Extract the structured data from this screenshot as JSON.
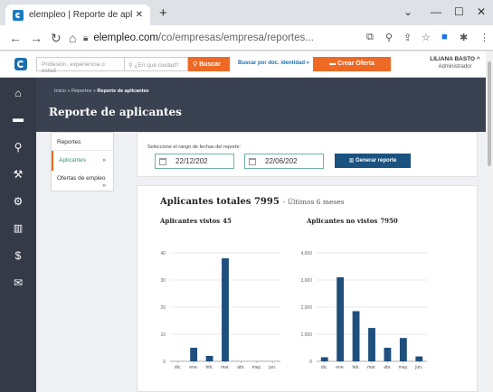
{
  "browser": {
    "tab_title": "elempleo | Reporte de aplicantes",
    "tab_close": "✕",
    "new_tab": "+",
    "url_host": "elempleo.com",
    "url_path": "/co/empresas/empresa/reportes...",
    "window_controls": {
      "chevron": "⌄",
      "minimize": "—",
      "maximize": "☐",
      "close": "✕"
    }
  },
  "site": {
    "search_placeholder": "Profesión, experiencia o estud",
    "city_placeholder": "¿En qué ciudad?",
    "search_button": "Buscar",
    "doc_search_link": "Buscar por doc. identidad »",
    "create_offer_button": "Crear Oferta",
    "user_name": "LILIANA BASTO",
    "user_role": "Administrador"
  },
  "page": {
    "breadcrumb": {
      "home": "Inicio",
      "sep": "»",
      "reports": "Reportes",
      "current": "Reporte de aplicantes"
    },
    "title": "Reporte de aplicantes"
  },
  "report_menu": {
    "header": "Reportes",
    "items": [
      {
        "label": "Aplicantes",
        "chevron": "»"
      },
      {
        "label": "Ofertas de empleo",
        "chevron": "»"
      }
    ]
  },
  "filter": {
    "label": "Seleccione el rango de fechas del reporte:",
    "date_from": "22/12/202",
    "date_to": "22/06/202",
    "generate_button": "Generar reporte"
  },
  "totals": {
    "label": "Aplicantes totales",
    "value": "7995",
    "period": "- Últimos 6 meses"
  },
  "chart_data": [
    {
      "type": "bar",
      "title": "Aplicantes vistos",
      "total": "45",
      "categories": [
        "dic.",
        "ene.",
        "feb.",
        "mar.",
        "abr.",
        "may.",
        "jun."
      ],
      "values": [
        0,
        5,
        2,
        38,
        0,
        0,
        0
      ],
      "ylim": [
        0,
        40
      ],
      "yticks": [
        0,
        10,
        20,
        30,
        40
      ],
      "ytick_labels": [
        "0",
        "10",
        "20",
        "30",
        "40"
      ],
      "color": "#1f4f7c",
      "grid": true
    },
    {
      "type": "bar",
      "title": "Aplicantes no vistos",
      "total": "7950",
      "categories": [
        "dic.",
        "ene.",
        "feb.",
        "mar.",
        "abr.",
        "may.",
        "jun."
      ],
      "values": [
        150,
        3100,
        1850,
        1230,
        500,
        860,
        180
      ],
      "ylim": [
        0,
        4000
      ],
      "yticks": [
        0,
        1000,
        2000,
        3000,
        4000
      ],
      "ytick_labels": [
        "0",
        "1,000",
        "2,000",
        "3,000",
        "4,000"
      ],
      "color": "#1f4f7c",
      "grid": true
    }
  ]
}
